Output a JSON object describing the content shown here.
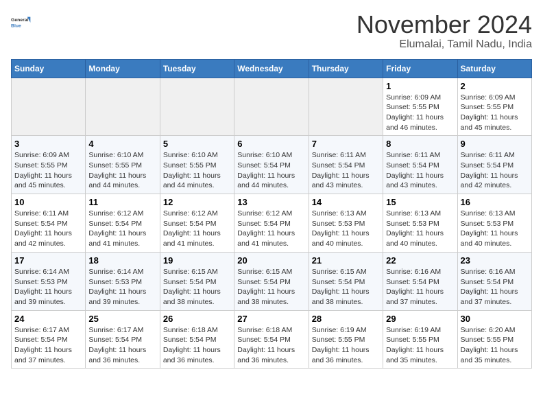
{
  "header": {
    "logo_general": "General",
    "logo_blue": "Blue",
    "month_title": "November 2024",
    "location": "Elumalai, Tamil Nadu, India"
  },
  "weekdays": [
    "Sunday",
    "Monday",
    "Tuesday",
    "Wednesday",
    "Thursday",
    "Friday",
    "Saturday"
  ],
  "weeks": [
    [
      {
        "day": "",
        "info": ""
      },
      {
        "day": "",
        "info": ""
      },
      {
        "day": "",
        "info": ""
      },
      {
        "day": "",
        "info": ""
      },
      {
        "day": "",
        "info": ""
      },
      {
        "day": "1",
        "info": "Sunrise: 6:09 AM\nSunset: 5:55 PM\nDaylight: 11 hours\nand 46 minutes."
      },
      {
        "day": "2",
        "info": "Sunrise: 6:09 AM\nSunset: 5:55 PM\nDaylight: 11 hours\nand 45 minutes."
      }
    ],
    [
      {
        "day": "3",
        "info": "Sunrise: 6:09 AM\nSunset: 5:55 PM\nDaylight: 11 hours\nand 45 minutes."
      },
      {
        "day": "4",
        "info": "Sunrise: 6:10 AM\nSunset: 5:55 PM\nDaylight: 11 hours\nand 44 minutes."
      },
      {
        "day": "5",
        "info": "Sunrise: 6:10 AM\nSunset: 5:55 PM\nDaylight: 11 hours\nand 44 minutes."
      },
      {
        "day": "6",
        "info": "Sunrise: 6:10 AM\nSunset: 5:54 PM\nDaylight: 11 hours\nand 44 minutes."
      },
      {
        "day": "7",
        "info": "Sunrise: 6:11 AM\nSunset: 5:54 PM\nDaylight: 11 hours\nand 43 minutes."
      },
      {
        "day": "8",
        "info": "Sunrise: 6:11 AM\nSunset: 5:54 PM\nDaylight: 11 hours\nand 43 minutes."
      },
      {
        "day": "9",
        "info": "Sunrise: 6:11 AM\nSunset: 5:54 PM\nDaylight: 11 hours\nand 42 minutes."
      }
    ],
    [
      {
        "day": "10",
        "info": "Sunrise: 6:11 AM\nSunset: 5:54 PM\nDaylight: 11 hours\nand 42 minutes."
      },
      {
        "day": "11",
        "info": "Sunrise: 6:12 AM\nSunset: 5:54 PM\nDaylight: 11 hours\nand 41 minutes."
      },
      {
        "day": "12",
        "info": "Sunrise: 6:12 AM\nSunset: 5:54 PM\nDaylight: 11 hours\nand 41 minutes."
      },
      {
        "day": "13",
        "info": "Sunrise: 6:12 AM\nSunset: 5:54 PM\nDaylight: 11 hours\nand 41 minutes."
      },
      {
        "day": "14",
        "info": "Sunrise: 6:13 AM\nSunset: 5:53 PM\nDaylight: 11 hours\nand 40 minutes."
      },
      {
        "day": "15",
        "info": "Sunrise: 6:13 AM\nSunset: 5:53 PM\nDaylight: 11 hours\nand 40 minutes."
      },
      {
        "day": "16",
        "info": "Sunrise: 6:13 AM\nSunset: 5:53 PM\nDaylight: 11 hours\nand 40 minutes."
      }
    ],
    [
      {
        "day": "17",
        "info": "Sunrise: 6:14 AM\nSunset: 5:53 PM\nDaylight: 11 hours\nand 39 minutes."
      },
      {
        "day": "18",
        "info": "Sunrise: 6:14 AM\nSunset: 5:53 PM\nDaylight: 11 hours\nand 39 minutes."
      },
      {
        "day": "19",
        "info": "Sunrise: 6:15 AM\nSunset: 5:54 PM\nDaylight: 11 hours\nand 38 minutes."
      },
      {
        "day": "20",
        "info": "Sunrise: 6:15 AM\nSunset: 5:54 PM\nDaylight: 11 hours\nand 38 minutes."
      },
      {
        "day": "21",
        "info": "Sunrise: 6:15 AM\nSunset: 5:54 PM\nDaylight: 11 hours\nand 38 minutes."
      },
      {
        "day": "22",
        "info": "Sunrise: 6:16 AM\nSunset: 5:54 PM\nDaylight: 11 hours\nand 37 minutes."
      },
      {
        "day": "23",
        "info": "Sunrise: 6:16 AM\nSunset: 5:54 PM\nDaylight: 11 hours\nand 37 minutes."
      }
    ],
    [
      {
        "day": "24",
        "info": "Sunrise: 6:17 AM\nSunset: 5:54 PM\nDaylight: 11 hours\nand 37 minutes."
      },
      {
        "day": "25",
        "info": "Sunrise: 6:17 AM\nSunset: 5:54 PM\nDaylight: 11 hours\nand 36 minutes."
      },
      {
        "day": "26",
        "info": "Sunrise: 6:18 AM\nSunset: 5:54 PM\nDaylight: 11 hours\nand 36 minutes."
      },
      {
        "day": "27",
        "info": "Sunrise: 6:18 AM\nSunset: 5:54 PM\nDaylight: 11 hours\nand 36 minutes."
      },
      {
        "day": "28",
        "info": "Sunrise: 6:19 AM\nSunset: 5:55 PM\nDaylight: 11 hours\nand 36 minutes."
      },
      {
        "day": "29",
        "info": "Sunrise: 6:19 AM\nSunset: 5:55 PM\nDaylight: 11 hours\nand 35 minutes."
      },
      {
        "day": "30",
        "info": "Sunrise: 6:20 AM\nSunset: 5:55 PM\nDaylight: 11 hours\nand 35 minutes."
      }
    ]
  ]
}
